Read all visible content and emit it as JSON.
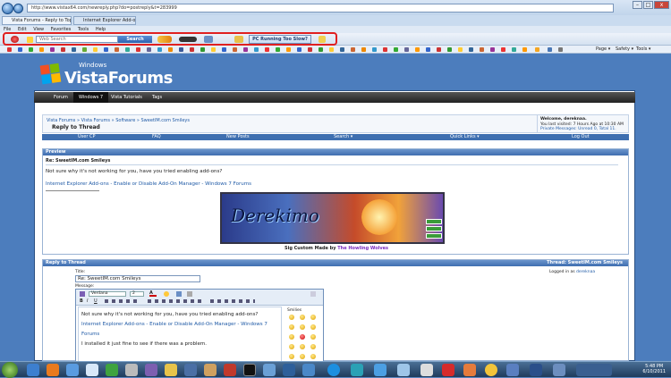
{
  "browser": {
    "address": "http://www.vistax64.com/newreply.php?do=postreply&t=283999",
    "tabs": [
      "Vista Forums - Reply to Topic",
      "Internet Explorer Add-ons - En..."
    ],
    "menu": [
      "File",
      "Edit",
      "View",
      "Favorites",
      "Tools",
      "Help"
    ],
    "search_placeholder": "Web Search",
    "search_label": "Search",
    "pc_button": "PC Running Too Slow?",
    "right_tools": [
      "Page ▾",
      "Safety ▾",
      "Tools ▾"
    ]
  },
  "logo": {
    "small": "Windows",
    "big": "VistaForums"
  },
  "nav": [
    "Forum",
    "Windows 7",
    "Vista Tutorials",
    "Tags"
  ],
  "breadcrumb": {
    "trail": "Vista Forums » Vista Forums » Software » SweetIM.com Smileys",
    "title": "Reply to Thread"
  },
  "welcome": {
    "line1": "Welcome, dereknaa.",
    "line2": "You last visited: 7 Hours Ago at 10:30 AM",
    "line3": "Private Messages: Unread 0, Total 11."
  },
  "bluebar": [
    "User CP",
    "FAQ",
    "New Posts",
    "Search ▾",
    "Quick Links ▾",
    "Log Out"
  ],
  "preview": {
    "head": "Preview",
    "subject": "Re: SweetIM.com Smileys",
    "body": "Not sure why it's not working for you, have you tried enabling add-ons?",
    "link": "Internet Explorer Add-ons - Enable or Disable Add-On Manager - Windows 7 Forums",
    "banner_text": "Derekimo",
    "sig_prefix": "Sig Custom Made by",
    "sig_author": "The Howling Wolves"
  },
  "reply": {
    "head": "Reply to Thread",
    "thread_label": "Thread:",
    "thread_name": "SweetIM.com Smileys",
    "title_label": "Title:",
    "title_value": "Re: SweetIM.com Smileys",
    "logged": "Logged in as",
    "user": "dereknaa",
    "message_label": "Message:",
    "font": "Verdana",
    "size": "2",
    "line1": "Not sure why it's not working for you, have you tried enabling add-ons?",
    "line2": "Internet Explorer Add-ons - Enable or Disable Add-On Manager - Windows 7 Forums",
    "line3": "I installed it just fine to see if there was a problem.",
    "smilies": "Smilies"
  },
  "clock": {
    "time": "5:48 PM",
    "date": "6/10/2011"
  }
}
